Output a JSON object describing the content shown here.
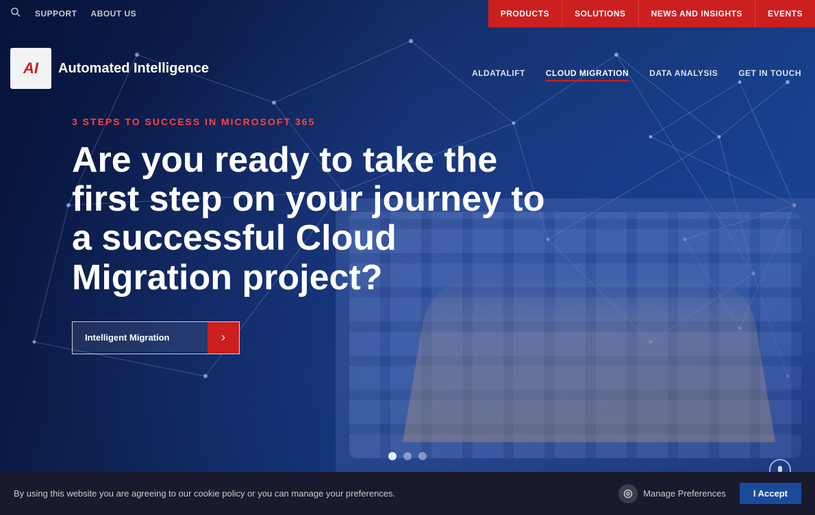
{
  "topnav": {
    "search_placeholder": "Search",
    "links": [
      {
        "id": "support",
        "label": "SUPPORT"
      },
      {
        "id": "about-us",
        "label": "ABOUT US"
      }
    ],
    "buttons": [
      {
        "id": "products",
        "label": "PRODUCTS"
      },
      {
        "id": "solutions",
        "label": "SOLUTIONS"
      },
      {
        "id": "news-insights",
        "label": "NEWS AND INSIGHTS"
      },
      {
        "id": "events",
        "label": "EVENTS"
      }
    ]
  },
  "logo": {
    "icon": "AI",
    "name": "Automated Intelligence"
  },
  "secondarynav": {
    "links": [
      {
        "id": "aldatalift",
        "label": "ALDATALIFT",
        "active": false
      },
      {
        "id": "cloud-migration",
        "label": "CLOUD MIGRATION",
        "active": true
      },
      {
        "id": "data-analysis",
        "label": "DATA ANALYSIS",
        "active": false
      },
      {
        "id": "get-in-touch",
        "label": "GET IN TOUCH",
        "active": false
      }
    ]
  },
  "hero": {
    "subtitle": "3 STEPS TO SUCCESS IN MICROSOFT 365",
    "title": "Are you ready to take the first step on your journey to a successful Cloud Migration project?",
    "cta_label": "Intelligent Migration",
    "cta_arrow": "›",
    "dots": [
      {
        "id": 1,
        "active": true
      },
      {
        "id": 2,
        "active": false
      },
      {
        "id": 3,
        "active": false
      }
    ]
  },
  "cookie": {
    "message": "By using this website you are agreeing to our cookie policy or you can manage your preferences.",
    "manage_label": "Manage Preferences",
    "accept_label": "I Accept"
  }
}
